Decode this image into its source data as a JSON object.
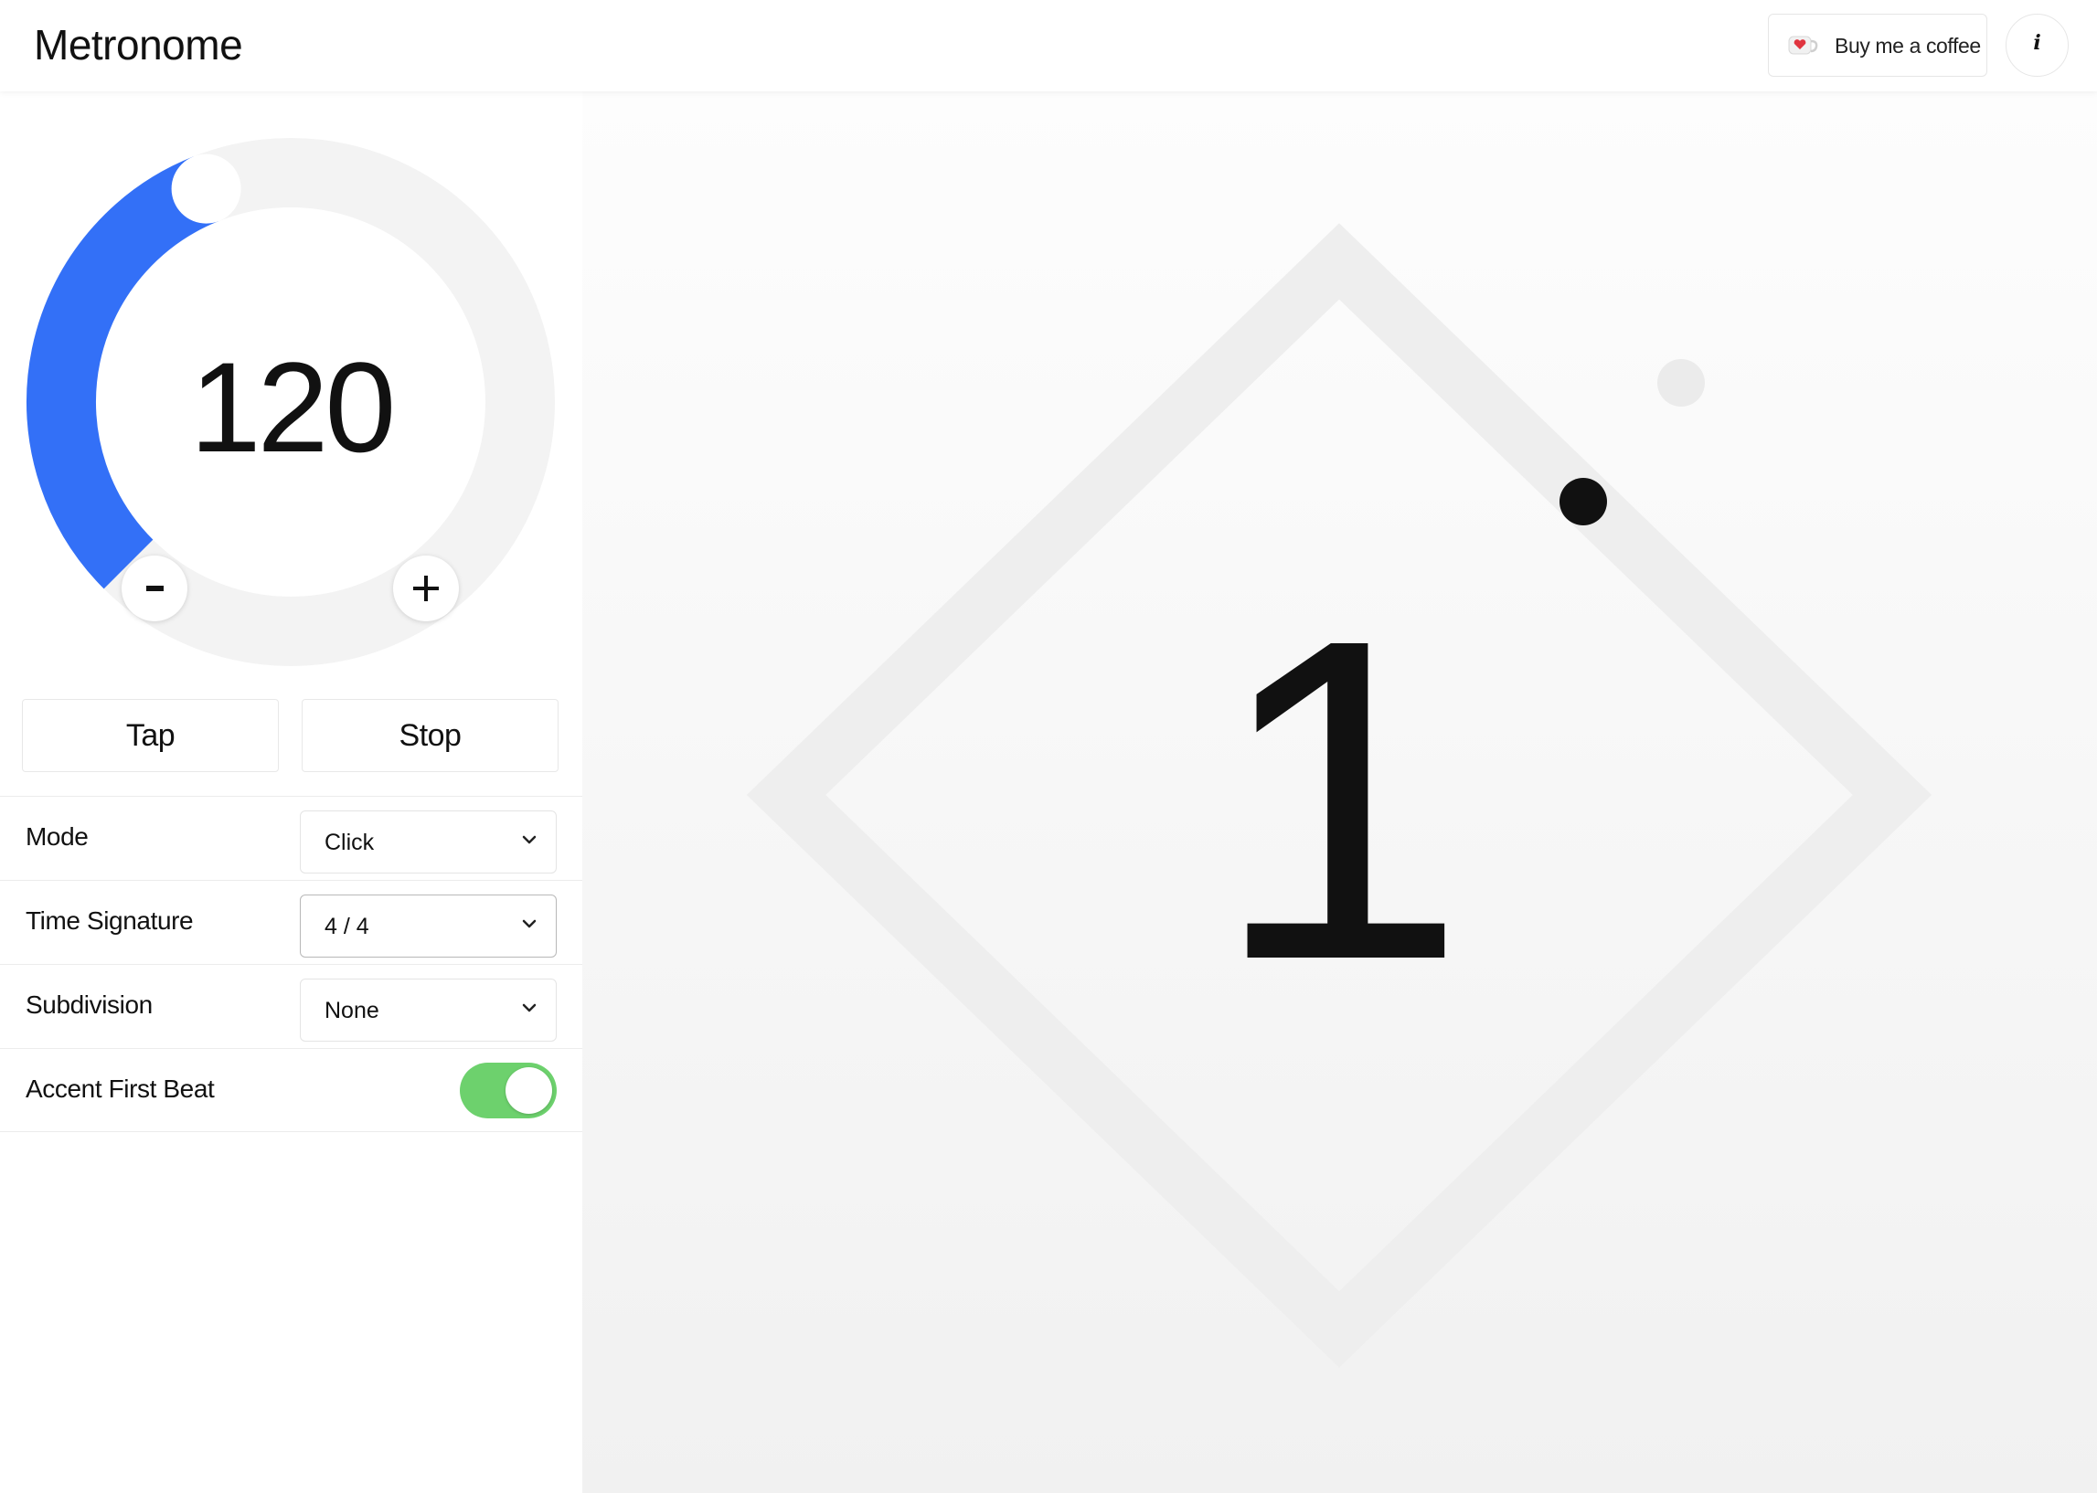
{
  "header": {
    "title": "Metronome",
    "coffee_label": "Buy me a coffee",
    "info_glyph": "i"
  },
  "tempo": {
    "bpm": "120",
    "dial_fill_fraction": 0.42,
    "decrement_glyph": "−",
    "increment_glyph": "+"
  },
  "buttons": {
    "tap": "Tap",
    "stop": "Stop"
  },
  "settings": {
    "mode": {
      "label": "Mode",
      "value": "Click"
    },
    "time_signature": {
      "label": "Time Signature",
      "value": "4 / 4"
    },
    "subdivision": {
      "label": "Subdivision",
      "value": "None"
    },
    "accent_first_beat": {
      "label": "Accent First Beat",
      "enabled": true
    }
  },
  "visualizer": {
    "beat": "1"
  },
  "colors": {
    "accent": "#3370f7",
    "dial_track": "#f3f3f3",
    "toggle_on": "#6dd16d",
    "diamond": "#eeeeee",
    "dot_active": "#111111",
    "dot_inactive": "#ebebeb"
  },
  "icons": {
    "coffee": "coffee-cup-heart-icon",
    "info": "info-icon",
    "chevron": "chevron-down-icon"
  }
}
